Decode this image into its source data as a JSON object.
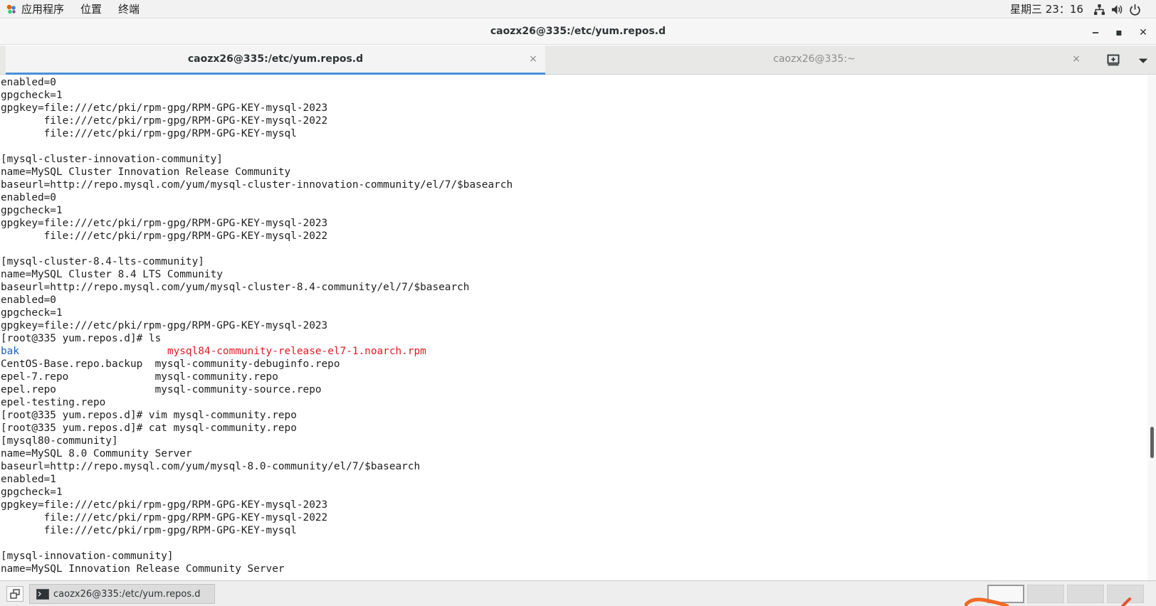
{
  "top_panel": {
    "menu": [
      "应用程序",
      "位置",
      "终端"
    ],
    "clock": "星期三 23：16",
    "tray_icons": [
      "network-icon",
      "volume-icon",
      "power-icon"
    ]
  },
  "window": {
    "title": "caozx26@335:/etc/yum.repos.d",
    "controls": {
      "minimize": "‒",
      "maximize": "▪",
      "close": "✕"
    }
  },
  "tabs": [
    {
      "label": "caozx26@335:/etc/yum.repos.d",
      "active": true,
      "close": "×"
    },
    {
      "label": "caozx26@335:~",
      "active": false,
      "close": "×"
    }
  ],
  "terminal": {
    "lines": [
      [
        {
          "t": "enabled=0"
        }
      ],
      [
        {
          "t": "gpgcheck=1"
        }
      ],
      [
        {
          "t": "gpgkey=file:///etc/pki/rpm-gpg/RPM-GPG-KEY-mysql-2023"
        }
      ],
      [
        {
          "t": "       file:///etc/pki/rpm-gpg/RPM-GPG-KEY-mysql-2022"
        }
      ],
      [
        {
          "t": "       file:///etc/pki/rpm-gpg/RPM-GPG-KEY-mysql"
        }
      ],
      [
        {
          "t": ""
        }
      ],
      [
        {
          "t": "[mysql-cluster-innovation-community]"
        }
      ],
      [
        {
          "t": "name=MySQL Cluster Innovation Release Community"
        }
      ],
      [
        {
          "t": "baseurl=http://repo.mysql.com/yum/mysql-cluster-innovation-community/el/7/$basearch"
        }
      ],
      [
        {
          "t": "enabled=0"
        }
      ],
      [
        {
          "t": "gpgcheck=1"
        }
      ],
      [
        {
          "t": "gpgkey=file:///etc/pki/rpm-gpg/RPM-GPG-KEY-mysql-2023"
        }
      ],
      [
        {
          "t": "       file:///etc/pki/rpm-gpg/RPM-GPG-KEY-mysql-2022"
        }
      ],
      [
        {
          "t": ""
        }
      ],
      [
        {
          "t": "[mysql-cluster-8.4-lts-community]"
        }
      ],
      [
        {
          "t": "name=MySQL Cluster 8.4 LTS Community"
        }
      ],
      [
        {
          "t": "baseurl=http://repo.mysql.com/yum/mysql-cluster-8.4-community/el/7/$basearch"
        }
      ],
      [
        {
          "t": "enabled=0"
        }
      ],
      [
        {
          "t": "gpgcheck=1"
        }
      ],
      [
        {
          "t": "gpgkey=file:///etc/pki/rpm-gpg/RPM-GPG-KEY-mysql-2023"
        }
      ],
      [
        {
          "t": "[root@335 yum.repos.d]# ls"
        }
      ],
      [
        {
          "t": "bak",
          "c": "blue"
        },
        {
          "t": "                        "
        },
        {
          "t": "mysql84-community-release-el7-1.noarch.rpm",
          "c": "red"
        }
      ],
      [
        {
          "t": "CentOS-Base.repo.backup  mysql-community-debuginfo.repo"
        }
      ],
      [
        {
          "t": "epel-7.repo              mysql-community.repo"
        }
      ],
      [
        {
          "t": "epel.repo                mysql-community-source.repo"
        }
      ],
      [
        {
          "t": "epel-testing.repo"
        }
      ],
      [
        {
          "t": "[root@335 yum.repos.d]# vim mysql-community.repo"
        }
      ],
      [
        {
          "t": "[root@335 yum.repos.d]# cat mysql-community.repo"
        }
      ],
      [
        {
          "t": "[mysql80-community]"
        }
      ],
      [
        {
          "t": "name=MySQL 8.0 Community Server"
        }
      ],
      [
        {
          "t": "baseurl=http://repo.mysql.com/yum/mysql-8.0-community/el/7/$basearch"
        }
      ],
      [
        {
          "t": "enabled=1"
        }
      ],
      [
        {
          "t": "gpgcheck=1"
        }
      ],
      [
        {
          "t": "gpgkey=file:///etc/pki/rpm-gpg/RPM-GPG-KEY-mysql-2023"
        }
      ],
      [
        {
          "t": "       file:///etc/pki/rpm-gpg/RPM-GPG-KEY-mysql-2022"
        }
      ],
      [
        {
          "t": "       file:///etc/pki/rpm-gpg/RPM-GPG-KEY-mysql"
        }
      ],
      [
        {
          "t": ""
        }
      ],
      [
        {
          "t": "[mysql-innovation-community]"
        }
      ],
      [
        {
          "t": "name=MySQL Innovation Release Community Server"
        }
      ]
    ]
  },
  "taskbar": {
    "task_label": "caozx26@335:/etc/yum.repos.d",
    "workspaces": 4,
    "active_workspace": 1
  },
  "colors": {
    "accent": "#4a90d9",
    "term_red": "#e01b24",
    "term_blue": "#1a5fb4",
    "term_fg": "#1e1e1e"
  }
}
